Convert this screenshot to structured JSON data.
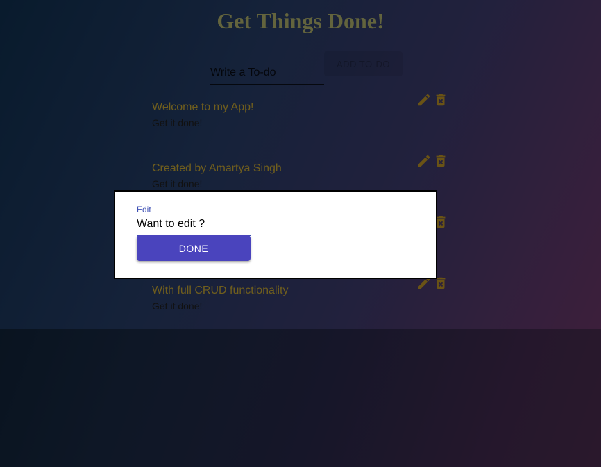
{
  "app": {
    "title": "Get Things Done!"
  },
  "new_todo": {
    "placeholder": "Write a To-do",
    "add_label": "ADD TO-DO"
  },
  "todos": [
    {
      "text": "Welcome to my App!",
      "subtext": "Get it done!"
    },
    {
      "text": "Created by Amartya Singh",
      "subtext": "Get it done!"
    },
    {
      "text": "",
      "subtext": ""
    },
    {
      "text": "With full CRUD functionality",
      "subtext": "Get it done!"
    }
  ],
  "icons": {
    "edit": "pencil-icon",
    "delete": "delete-icon"
  },
  "colors": {
    "title": "#c6c97a",
    "todo_text": "#e0bd3a",
    "icon": "#d4a62a",
    "primary": "#4a44bd",
    "label": "#3f51b5"
  },
  "edit_dialog": {
    "label": "Edit",
    "placeholder": "Want to edit ?",
    "done_label": "DONE"
  }
}
